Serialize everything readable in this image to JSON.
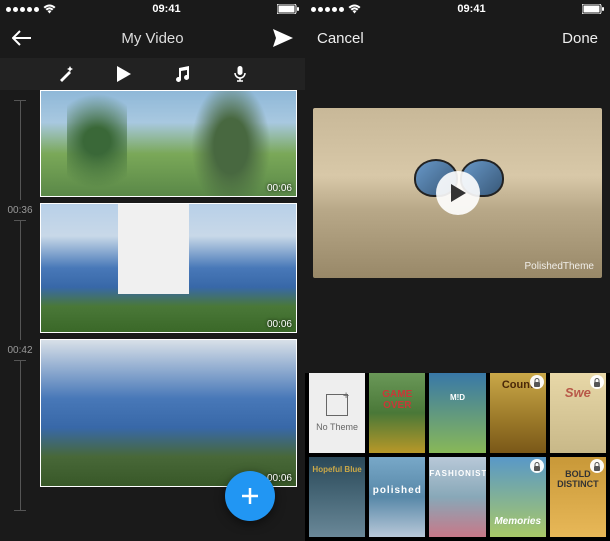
{
  "status": {
    "time": "09:41",
    "carrier_dots": 5,
    "wifi": true,
    "battery": 100
  },
  "left": {
    "nav": {
      "title": "My Video",
      "back_icon": "arrow-left",
      "send_icon": "send"
    },
    "toolbar": {
      "magic": "magic-wand",
      "play": "play",
      "music": "music-note",
      "mic": "microphone"
    },
    "timeline": {
      "marks": [
        "00:36",
        "00:42"
      ],
      "clips": [
        {
          "id": "clip1",
          "duration": "00:06"
        },
        {
          "id": "clip2",
          "duration": "00:06"
        },
        {
          "id": "clip3",
          "duration": "00:06"
        }
      ]
    },
    "fab_icon": "plus"
  },
  "right": {
    "nav": {
      "cancel": "Cancel",
      "done": "Done"
    },
    "preview": {
      "watermark": "PolishedTheme",
      "play_icon": "play"
    },
    "themes": [
      {
        "label": "No Theme",
        "locked": false,
        "cls": "no-theme"
      },
      {
        "label": "GAME OVER",
        "locked": false,
        "cls": "th-over"
      },
      {
        "label": "M!D",
        "locked": false,
        "cls": "th-mid"
      },
      {
        "label": "Count",
        "locked": true,
        "cls": "th-count"
      },
      {
        "label": "Swe",
        "locked": true,
        "cls": "th-swe"
      },
      {
        "label": "Hopeful Blue",
        "locked": false,
        "cls": "th-hope"
      },
      {
        "label": "polished",
        "locked": false,
        "cls": "th-pol"
      },
      {
        "label": "FASHIONISTA",
        "locked": false,
        "cls": "th-fash"
      },
      {
        "label": "Memories",
        "locked": true,
        "cls": "th-mem"
      },
      {
        "label": "BOLD DISTINCT",
        "locked": true,
        "cls": "th-bold"
      }
    ]
  }
}
